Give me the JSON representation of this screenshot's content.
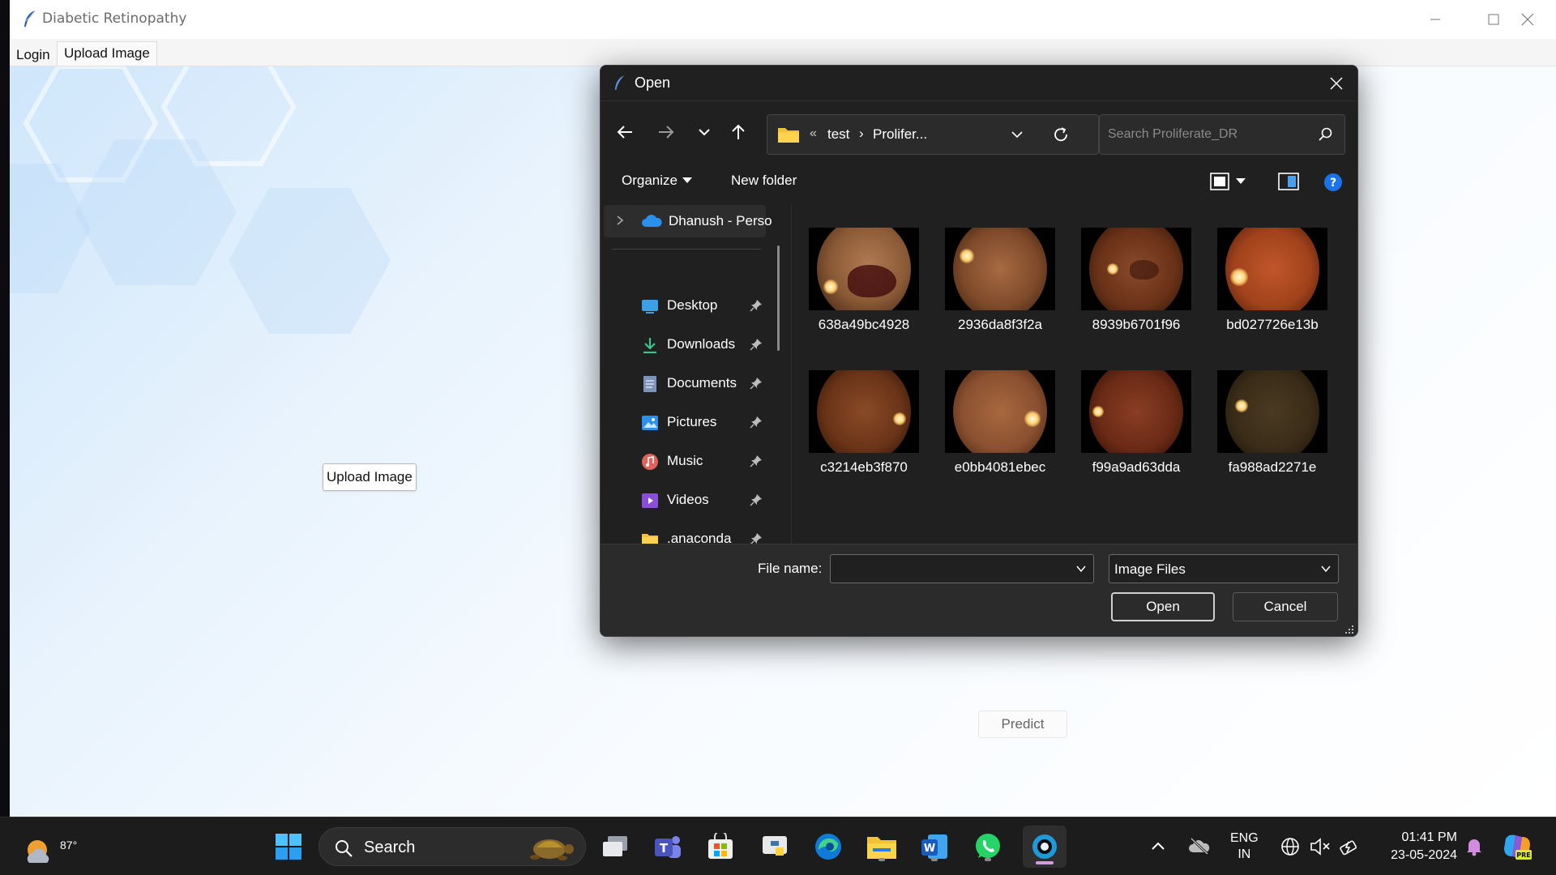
{
  "app": {
    "title": "Diabetic Retinopathy",
    "menu": {
      "login_label": "Login",
      "upload_tab_label": "Upload Image"
    },
    "upload_button_label": "Upload Image",
    "predict_button_label": "Predict"
  },
  "dialog": {
    "title": "Open",
    "address": {
      "separator": "«",
      "crumbs": [
        "test",
        "Prolifer..."
      ],
      "crumb_sep": "›"
    },
    "search_placeholder": "Search Proliferate_DR",
    "toolbar": {
      "organize_label": "Organize",
      "new_folder_label": "New folder"
    },
    "sidebar": {
      "onedrive_label": "Dhanush - Perso",
      "items": [
        {
          "label": "Desktop",
          "icon": "desktop-icon"
        },
        {
          "label": "Downloads",
          "icon": "downloads-icon"
        },
        {
          "label": "Documents",
          "icon": "documents-icon"
        },
        {
          "label": "Pictures",
          "icon": "pictures-icon"
        },
        {
          "label": "Music",
          "icon": "music-icon"
        },
        {
          "label": "Videos",
          "icon": "videos-icon"
        },
        {
          "label": ".anaconda",
          "icon": "folder-icon"
        }
      ]
    },
    "files": [
      {
        "name": "638a49bc4928"
      },
      {
        "name": "2936da8f3f2a"
      },
      {
        "name": "8939b6701f96"
      },
      {
        "name": "bd027726e13b"
      },
      {
        "name": "c3214eb3f870"
      },
      {
        "name": "e0bb4081ebec"
      },
      {
        "name": "f99a9ad63dda"
      },
      {
        "name": "fa988ad2271e"
      }
    ],
    "filename_label": "File name:",
    "filename_value": "",
    "filetype_value": "Image Files",
    "open_label": "Open",
    "cancel_label": "Cancel"
  },
  "taskbar": {
    "weather_temp": "87°",
    "search_label": "Search",
    "lang_line1": "ENG",
    "lang_line2": "IN",
    "time": "01:41 PM",
    "date": "23-05-2024"
  },
  "colors": {
    "accent": "#0078d4",
    "dialog_bg": "#202020",
    "taskbar_bg": "#1c1c1c"
  }
}
